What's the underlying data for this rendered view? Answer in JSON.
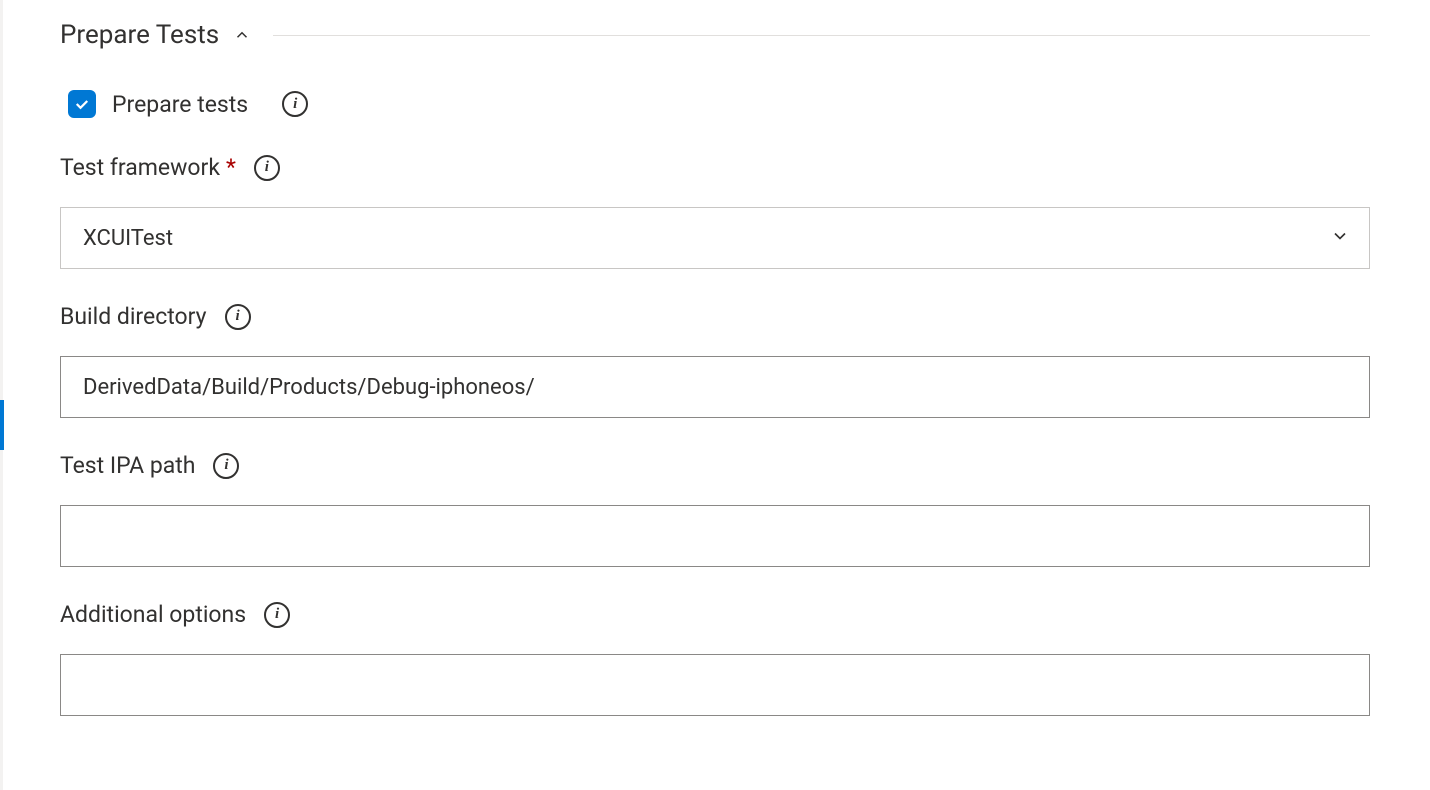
{
  "section": {
    "title": "Prepare Tests"
  },
  "checkbox": {
    "label": "Prepare tests",
    "checked": true
  },
  "fields": {
    "test_framework": {
      "label": "Test framework",
      "required": true,
      "value": "XCUITest"
    },
    "build_directory": {
      "label": "Build directory",
      "value": "DerivedData/Build/Products/Debug-iphoneos/"
    },
    "test_ipa_path": {
      "label": "Test IPA path",
      "value": ""
    },
    "additional_options": {
      "label": "Additional options",
      "value": ""
    }
  }
}
